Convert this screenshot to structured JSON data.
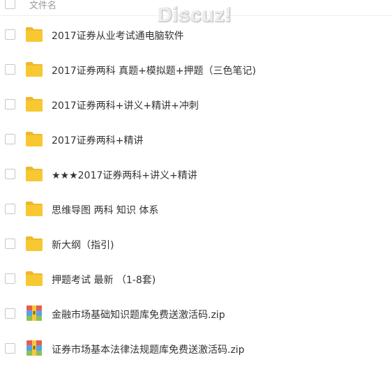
{
  "header": {
    "name_column_label": "文件名"
  },
  "watermark": "Discuz!",
  "files": [
    {
      "name": "2017证券从业考试通电脑软件",
      "type": "folder"
    },
    {
      "name": "2017证券两科 真题+模拟题+押题（三色笔记)",
      "type": "folder"
    },
    {
      "name": "2017证券两科+讲义+精讲+冲刺",
      "type": "folder"
    },
    {
      "name": "2017证券两科+精讲",
      "type": "folder"
    },
    {
      "name": "★★★2017证券两科+讲义+精讲",
      "type": "folder"
    },
    {
      "name": "思维导图 两科 知识 体系",
      "type": "folder"
    },
    {
      "name": "新大纲（指引)",
      "type": "folder"
    },
    {
      "name": "押题考试 最新 （1-8套)",
      "type": "folder"
    },
    {
      "name": "金融市场基础知识题库免费送激活码.zip",
      "type": "zip"
    },
    {
      "name": "证券市场基本法律法规题库免费送激活码.zip",
      "type": "zip"
    }
  ],
  "colors": {
    "folder": "#f8c833",
    "folder_tab": "#efb82a",
    "zip_top": "#e95b4f",
    "zip_mid": "#5aa0e6",
    "zip_bottom": "#8cc152",
    "zip_band": "#f4c842"
  },
  "icons": {
    "folder": "folder-icon",
    "zip": "zip-archive-icon"
  }
}
